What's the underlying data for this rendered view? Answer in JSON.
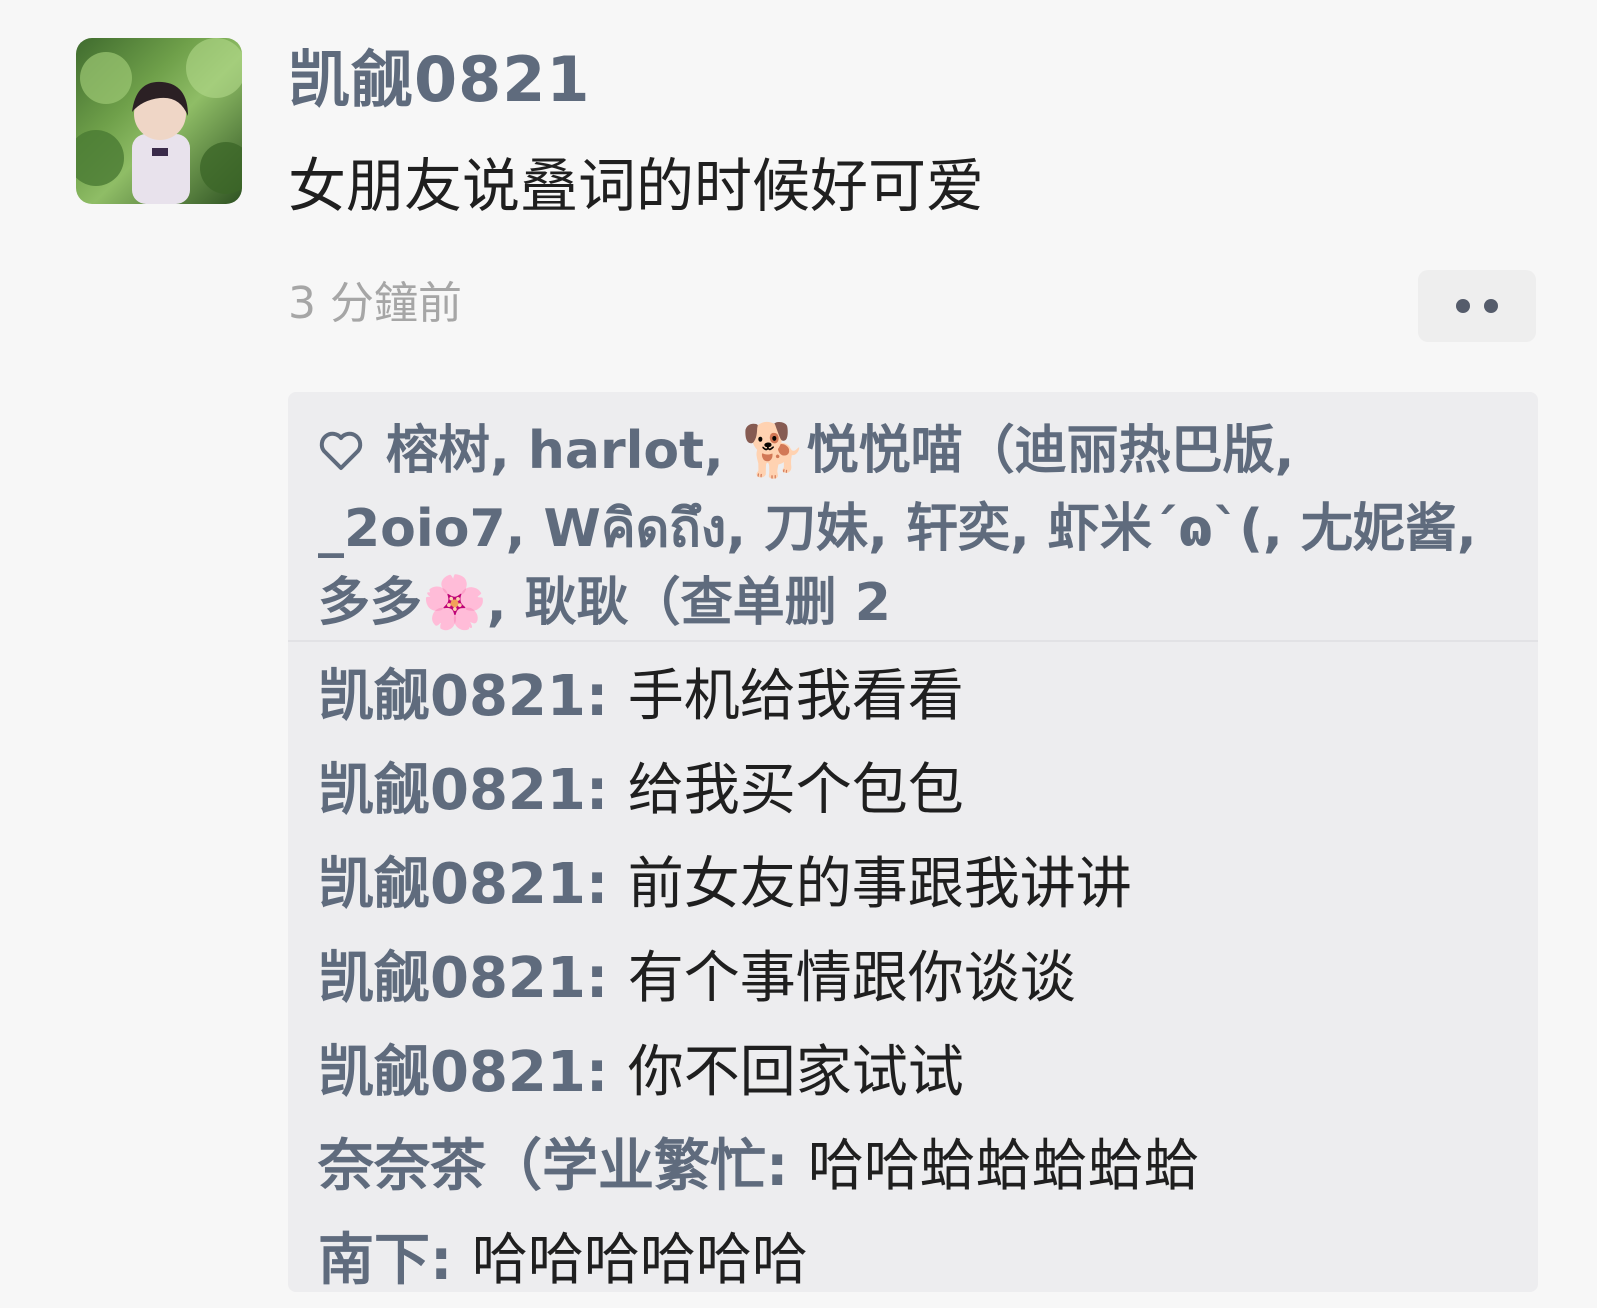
{
  "post": {
    "username": "凯觎0821",
    "text": "女朋友说叠词的时候好可爱",
    "timestamp": "3 分鐘前",
    "more_icon": "more-dots-icon"
  },
  "likes": {
    "icon": "heart-outline-icon",
    "text": "榕树, harlot, 🐕悦悦喵（迪丽热巴版, _2oio7, Wคิดถึง, 刀妹, 轩奕, 虾米ˊɷˋ(, 尢妮酱, 多多🌸, 耿耿（查单删 2"
  },
  "comments": [
    {
      "author": "凯觎0821",
      "separator": ": ",
      "content": "手机给我看看"
    },
    {
      "author": "凯觎0821",
      "separator": ": ",
      "content": "给我买个包包"
    },
    {
      "author": "凯觎0821",
      "separator": ": ",
      "content": "前女友的事跟我讲讲"
    },
    {
      "author": "凯觎0821",
      "separator": ": ",
      "content": "有个事情跟你谈谈"
    },
    {
      "author": "凯觎0821",
      "separator": ": ",
      "content": "你不回家试试"
    },
    {
      "author": "奈奈茶（学业繁忙",
      "separator": ": ",
      "content": "哈哈蛤蛤蛤蛤蛤"
    },
    {
      "author": "南下",
      "separator": ": ",
      "content": "哈哈哈哈哈哈"
    }
  ],
  "colors": {
    "name": "#5f6b7d",
    "text": "#1f1f1f",
    "timestamp": "#a6a6a6",
    "box": "#ededef"
  }
}
